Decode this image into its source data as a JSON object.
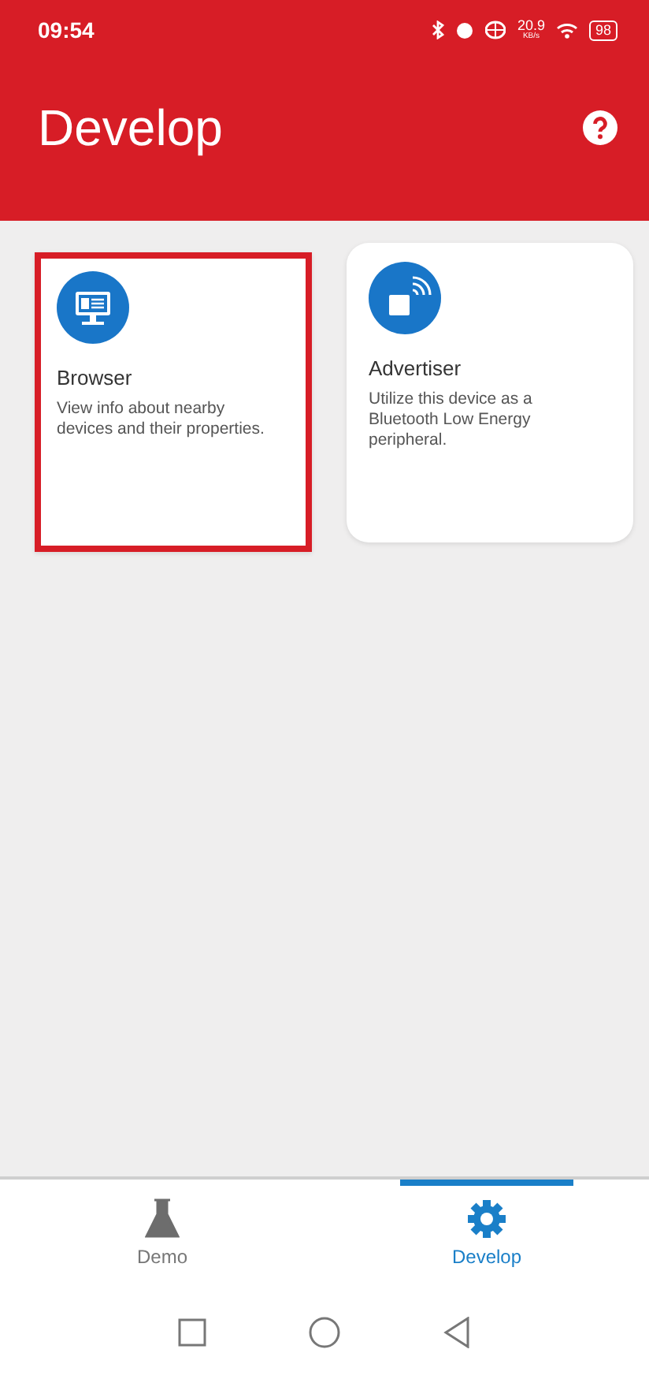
{
  "status_bar": {
    "time": "09:54",
    "speed": "20.9",
    "speed_unit": "KB/s",
    "battery": "98"
  },
  "app_bar": {
    "title": "Develop"
  },
  "cards": [
    {
      "kind": "browser",
      "title": "Browser",
      "description": "View info about nearby devices and their properties.",
      "highlighted": true
    },
    {
      "kind": "advertiser",
      "title": "Advertiser",
      "description": "Utilize this device as a Bluetooth Low Energy peripheral.",
      "highlighted": false
    }
  ],
  "bottom_nav": [
    {
      "kind": "demo",
      "label": "Demo",
      "selected": false
    },
    {
      "kind": "develop",
      "label": "Develop",
      "selected": true
    }
  ]
}
